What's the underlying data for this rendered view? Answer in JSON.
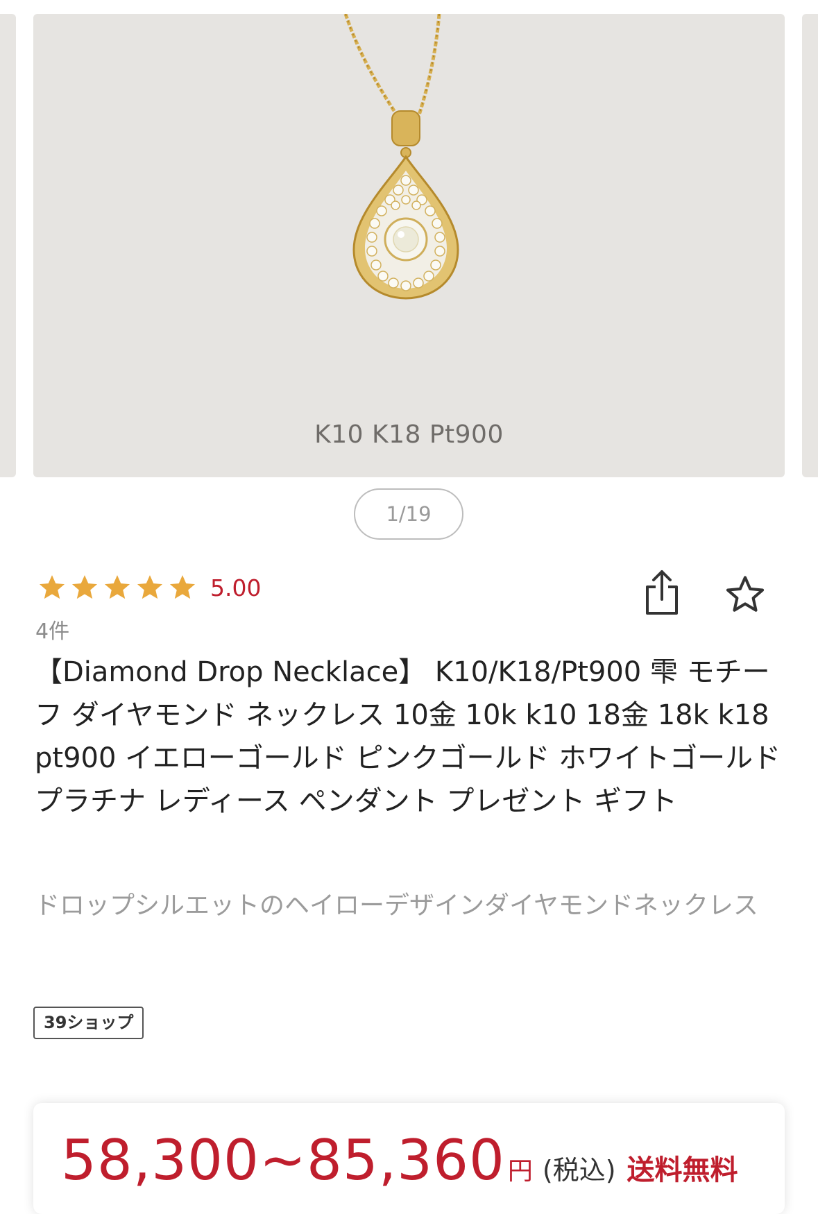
{
  "carousel": {
    "caption": "K10 K18 Pt900",
    "counter": "1/19",
    "image_alt": "diamond-drop-necklace-photo"
  },
  "rating": {
    "stars": 5,
    "max_stars": 5,
    "value": "5.00",
    "count_label": "4件"
  },
  "actions": {
    "share_icon": "share-icon",
    "favorite_icon": "star-outline-icon"
  },
  "product": {
    "title": "【Diamond Drop Necklace】 K10/K18/Pt900 雫 モチーフ ダイヤモンド ネックレス 10金 10k k10 18金 18k k18 pt900 イエローゴールド ピンクゴールド ホワイトゴールド プラチナ レディース ペンダント プレゼント ギフト",
    "description": "ドロップシルエットのヘイローデザインダイヤモンドネックレス",
    "shop_badge": "39ショップ"
  },
  "price": {
    "amount": "58,300~85,360",
    "unit": "円",
    "tax_label": "(税込)",
    "shipping_label": "送料無料"
  },
  "colors": {
    "accent_red": "#bf1e2d",
    "star_gold": "#e9a83c",
    "image_bg": "#e6e4e1",
    "gold_metal": "#d6ae4f"
  }
}
